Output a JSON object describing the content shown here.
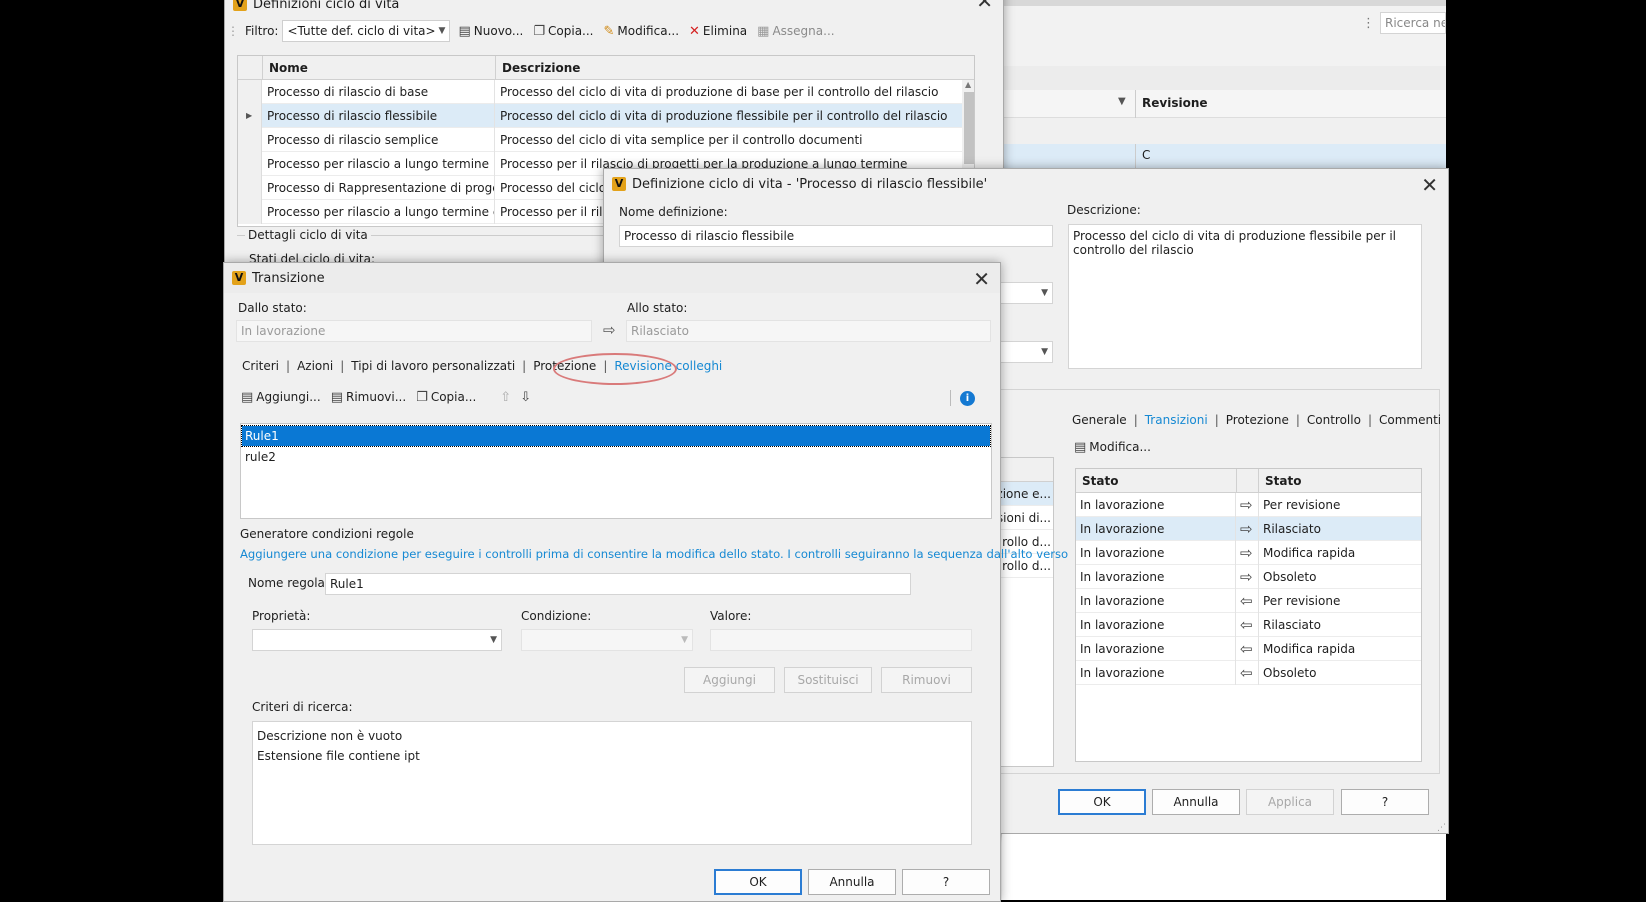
{
  "bg_window": {
    "search_placeholder": "Ricerca nella",
    "column_revisione": "Revisione",
    "revision_value": "C"
  },
  "lifecycle_list_window": {
    "title": "Definizioni ciclo di vita",
    "filter_label": "Filtro:",
    "filter_value": "<Tutte def. ciclo di vita>",
    "toolbar": {
      "new": "Nuovo...",
      "copy": "Copia...",
      "modify": "Modifica...",
      "delete": "Elimina",
      "assign": "Assegna..."
    },
    "columns": {
      "name": "Nome",
      "description": "Descrizione"
    },
    "rows": [
      {
        "name": "Processo di rilascio di base",
        "description": "Processo del ciclo di vita di produzione di base per il controllo del rilascio"
      },
      {
        "name": "Processo di rilascio flessibile",
        "description": "Processo del ciclo di vita di produzione flessibile per il controllo del rilascio"
      },
      {
        "name": "Processo di rilascio semplice",
        "description": "Processo del ciclo di vita semplice per il controllo documenti"
      },
      {
        "name": "Processo per rilascio a lungo termine",
        "description": "Processo per il rilascio di progetti per la produzione a lungo termine"
      },
      {
        "name": "Processo di Rappresentazione di progetto",
        "description": "Processo del ciclo"
      },
      {
        "name": "Processo per rilascio a lungo termine con O...",
        "description": "Processo per il rila"
      }
    ],
    "details_label": "Dettagli ciclo di vita",
    "states_label": "Stati del ciclo di vita:"
  },
  "definition_window": {
    "title": "Definizione ciclo di vita - 'Processo di rilascio flessibile'",
    "name_label": "Nome definizione:",
    "name_value": "Processo di rilascio flessibile",
    "description_label": "Descrizione:",
    "description_value": "Processo del ciclo di vita di produzione flessibile per il controllo del rilascio",
    "tabs": [
      "Generale",
      "Transizioni",
      "Protezione",
      "Controllo",
      "Commenti"
    ],
    "modify_label": "Modifica...",
    "columns": {
      "from": "Stato",
      "to": "Stato"
    },
    "left_list_fragments": [
      "zione e...",
      "sioni di...",
      "rollo d...",
      "rollo d..."
    ],
    "transitions": [
      {
        "from": "In lavorazione",
        "dir": "out",
        "to": "Per revisione"
      },
      {
        "from": "In lavorazione",
        "dir": "out",
        "to": "Rilasciato"
      },
      {
        "from": "In lavorazione",
        "dir": "out",
        "to": "Modifica rapida"
      },
      {
        "from": "In lavorazione",
        "dir": "out",
        "to": "Obsoleto"
      },
      {
        "from": "In lavorazione",
        "dir": "in",
        "to": "Per revisione"
      },
      {
        "from": "In lavorazione",
        "dir": "in",
        "to": "Rilasciato"
      },
      {
        "from": "In lavorazione",
        "dir": "in",
        "to": "Modifica rapida"
      },
      {
        "from": "In lavorazione",
        "dir": "in",
        "to": "Obsoleto"
      }
    ],
    "buttons": {
      "ok": "OK",
      "cancel": "Annulla",
      "apply": "Applica",
      "help": "?"
    }
  },
  "transition_window": {
    "title": "Transizione",
    "from_label": "Dallo stato:",
    "from_value": "In lavorazione",
    "to_label": "Allo stato:",
    "to_value": "Rilasciato",
    "tabs": [
      "Criteri",
      "Azioni",
      "Tipi di lavoro personalizzati",
      "Protezione",
      "Revisione colleghi"
    ],
    "toolbar": {
      "add": "Aggiungi...",
      "remove": "Rimuovi...",
      "copy": "Copia..."
    },
    "rules": [
      "Rule1",
      "rule2"
    ],
    "generator_label": "Generatore condizioni regole",
    "hint": "Aggiungere una condizione per eseguire i controlli prima di consentire la modifica dello stato. I controlli seguiranno la sequenza dall'alto verso",
    "rule_name_label": "Nome regola:",
    "rule_name_value": "Rule1",
    "property_label": "Proprietà:",
    "condition_label": "Condizione:",
    "value_label": "Valore:",
    "buttons_rule": {
      "add": "Aggiungi",
      "replace": "Sostituisci",
      "remove": "Rimuovi"
    },
    "search_criteria_label": "Criteri di ricerca:",
    "criteria": [
      "Descrizione non è vuoto",
      "Estensione file contiene ipt"
    ],
    "buttons": {
      "ok": "OK",
      "cancel": "Annulla",
      "help": "?"
    }
  }
}
